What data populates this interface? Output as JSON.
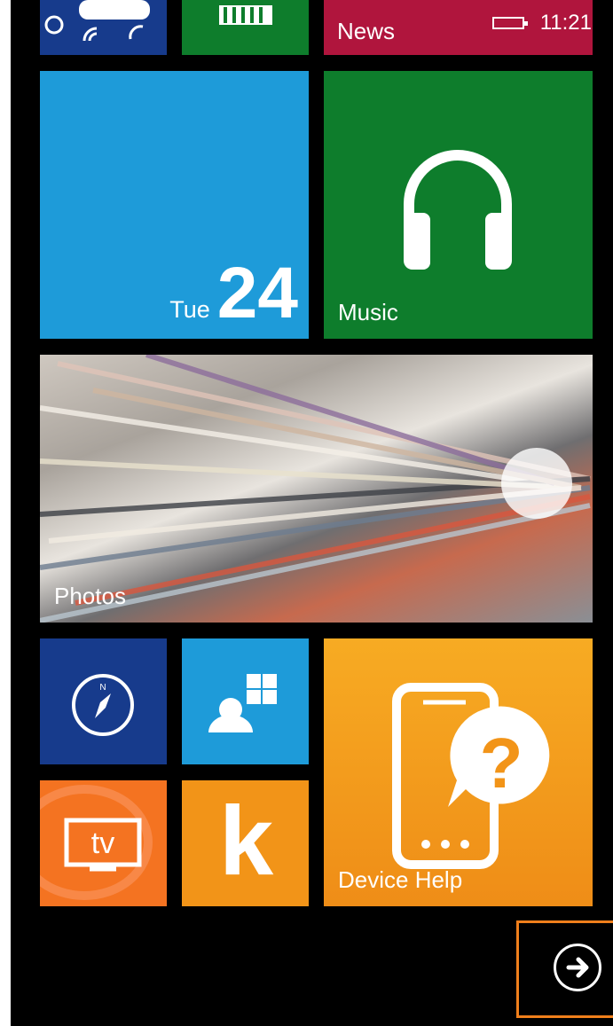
{
  "status": {
    "time": "11:21"
  },
  "tiles": {
    "news": {
      "label": "News",
      "color": "#b0153d"
    },
    "calendar": {
      "day": "Tue",
      "date": "24",
      "color": "#1e9bd9"
    },
    "music": {
      "label": "Music",
      "color": "#0e7d2c"
    },
    "photos": {
      "label": "Photos"
    },
    "maps": {
      "icon": "compass-icon",
      "color": "#173b8c"
    },
    "people": {
      "icon": "people-icon",
      "color": "#1e9bd9"
    },
    "device_help": {
      "label": "Device Help",
      "icon": "phone-question-icon",
      "color": "#f29418"
    },
    "tv": {
      "label": "tv",
      "icon": "tv-icon",
      "color": "#f47321"
    },
    "kindle": {
      "label": "k",
      "color": "#f29418"
    },
    "top_left": {
      "icon": "weather-icon",
      "color": "#173b8c"
    },
    "top_middle": {
      "icon": "store-icon",
      "color": "#0e7d2c"
    }
  },
  "nav": {
    "next_icon": "arrow-right-circle-icon"
  },
  "colors": {
    "highlight": "#f07f1b",
    "background": "#000000"
  }
}
